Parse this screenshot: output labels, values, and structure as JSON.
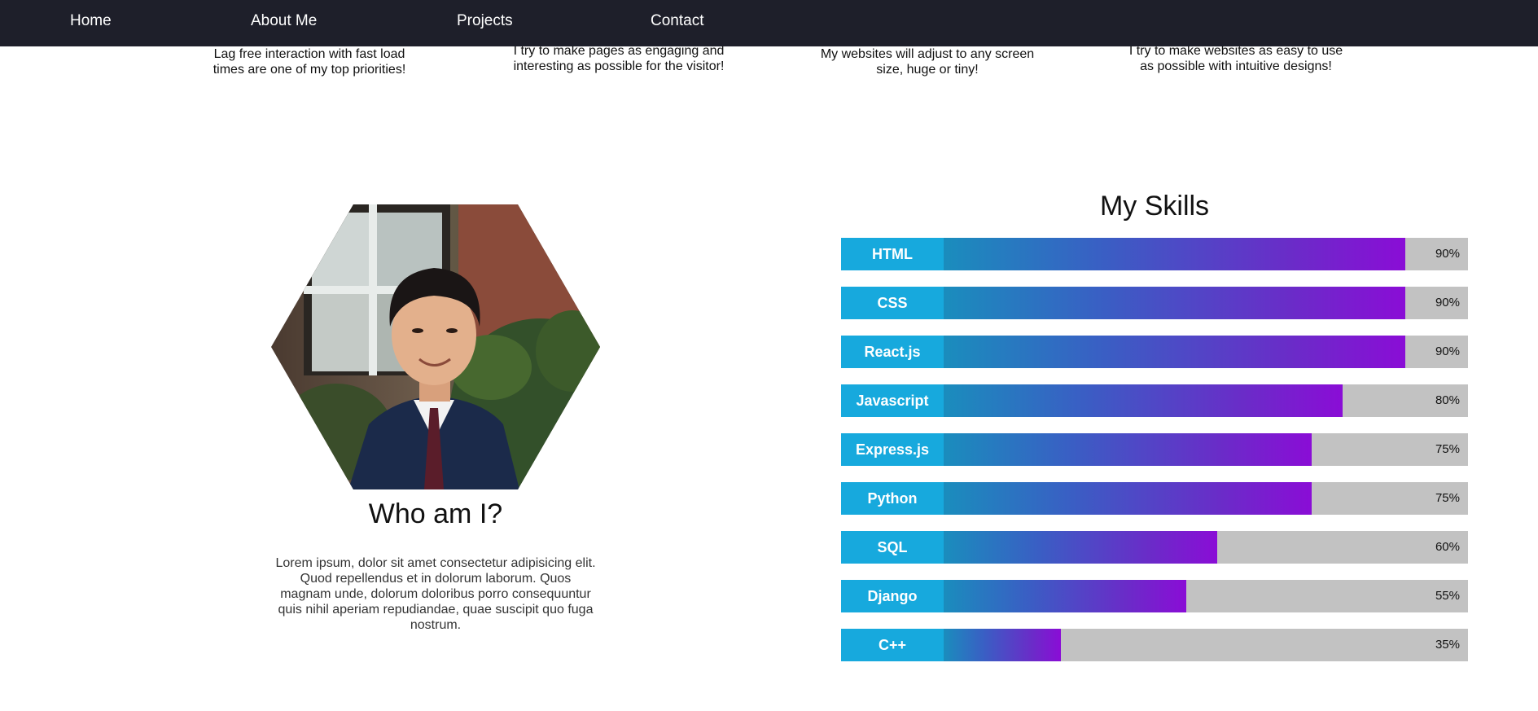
{
  "nav": {
    "links": [
      "Home",
      "About Me",
      "Projects",
      "Contact"
    ]
  },
  "features": [
    "Lag free interaction with fast load times are one of my top priorities!",
    "I try to make pages as engaging and interesting as possible for the visitor!",
    "My websites will adjust to any screen size, huge or tiny!",
    "I try to make websites as easy to use as possible with intuitive designs!"
  ],
  "profile": {
    "photo": "portrait-photo",
    "title": "Who am I?",
    "description": "Lorem ipsum, dolor sit amet consectetur adipisicing elit. Quod repellendus et in dolorum laborum. Quos magnam unde, dolorum doloribus porro consequuntur quis nihil aperiam repudiandae, quae suscipit quo fuga nostrum."
  },
  "skills": {
    "title": "My Skills",
    "items": [
      {
        "name": "HTML",
        "percent_label": "90%",
        "level": 0.9
      },
      {
        "name": "CSS",
        "percent_label": "90%",
        "level": 0.9
      },
      {
        "name": "React.js",
        "percent_label": "90%",
        "level": 0.9
      },
      {
        "name": "Javascript",
        "percent_label": "80%",
        "level": 0.8
      },
      {
        "name": "Express.js",
        "percent_label": "75%",
        "level": 0.75
      },
      {
        "name": "Python",
        "percent_label": "75%",
        "level": 0.75
      },
      {
        "name": "SQL",
        "percent_label": "60%",
        "level": 0.6
      },
      {
        "name": "Django",
        "percent_label": "55%",
        "level": 0.55
      },
      {
        "name": "C++",
        "percent_label": "35%",
        "level": 0.35
      }
    ]
  },
  "colors": {
    "navbar_bg": "#1e1f2a",
    "skill_label_bg": "#17a9dd",
    "skill_track_bg": "#c2c2c2",
    "skill_gradient_start": "#1a8dbd",
    "skill_gradient_end": "#8a0dd6"
  }
}
